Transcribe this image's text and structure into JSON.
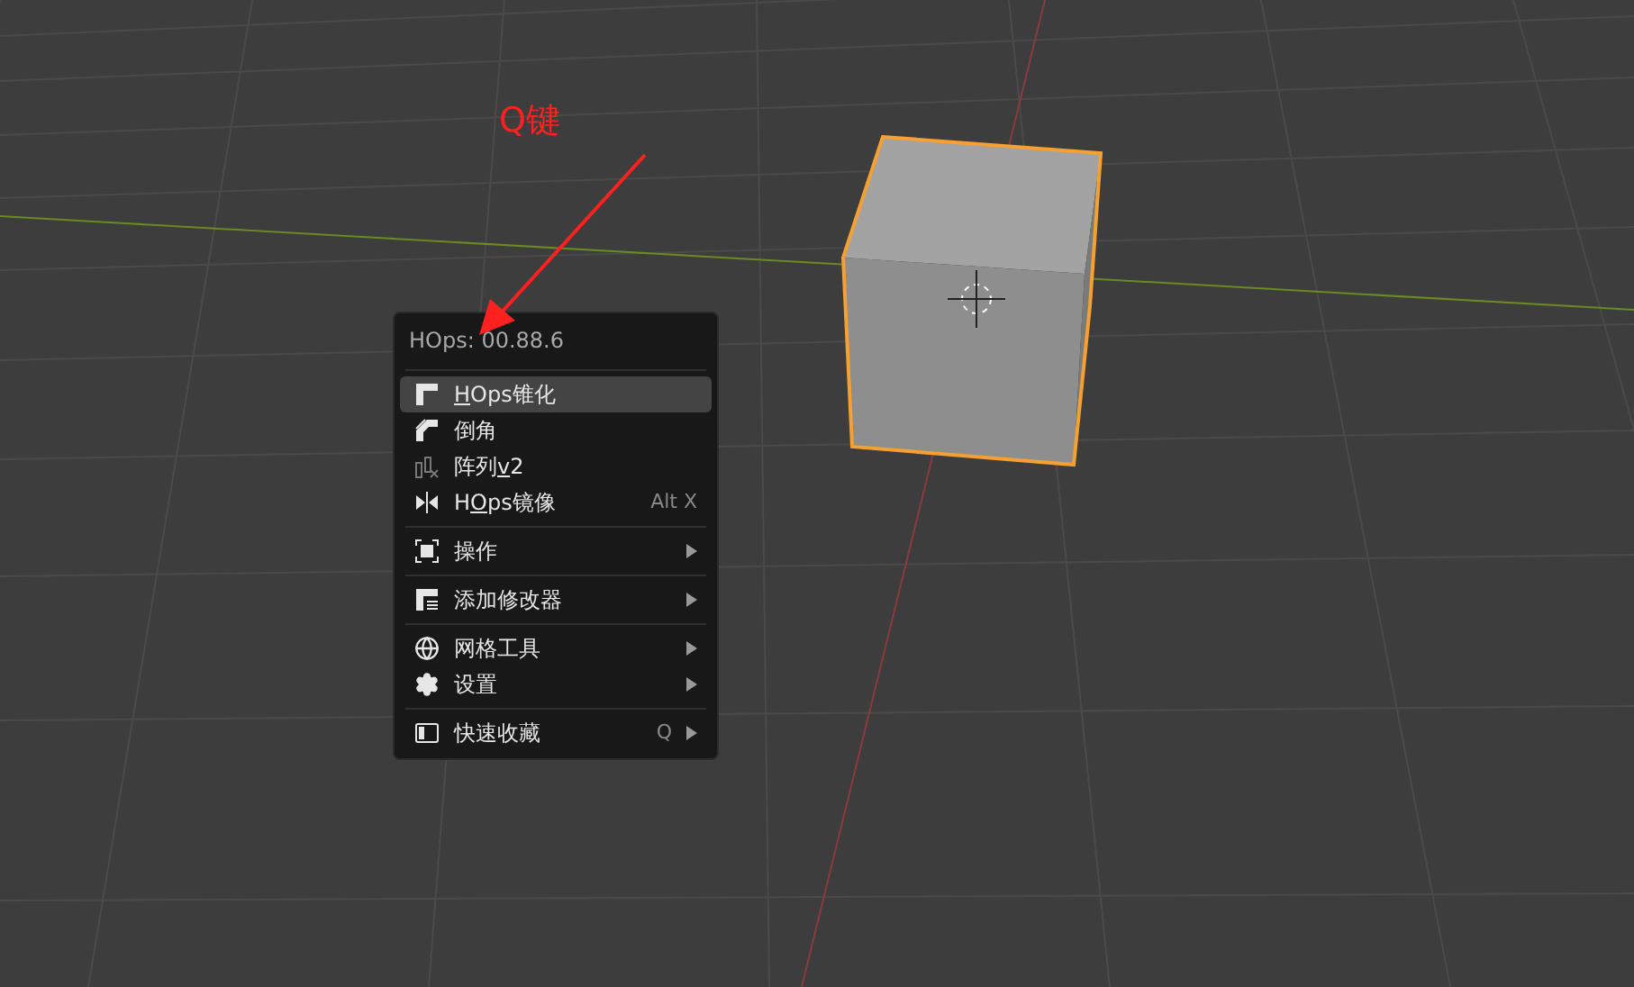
{
  "annotation": {
    "label": "Q键"
  },
  "menu": {
    "title": "HOps: 00.88.6",
    "groups": [
      [
        {
          "key": "H",
          "post": "Ops锥化",
          "selected": true,
          "submenu": false
        },
        {
          "post": "倒角",
          "selected": false,
          "submenu": false
        },
        {
          "pre": "阵列",
          "key": "v",
          "post": "2",
          "selected": false,
          "submenu": false
        },
        {
          "pre": "H",
          "key": "O",
          "post": "ps镜像",
          "shortcut": "Alt X",
          "selected": false,
          "submenu": false
        }
      ],
      [
        {
          "post": "操作",
          "selected": false,
          "submenu": true
        }
      ],
      [
        {
          "post": "添加修改器",
          "selected": false,
          "submenu": true
        }
      ],
      [
        {
          "post": "网格工具",
          "selected": false,
          "submenu": true
        },
        {
          "post": "设置",
          "selected": false,
          "submenu": true
        }
      ],
      [
        {
          "post": "快速收藏",
          "shortcut": "Q",
          "selected": false,
          "submenu": true
        }
      ]
    ]
  }
}
